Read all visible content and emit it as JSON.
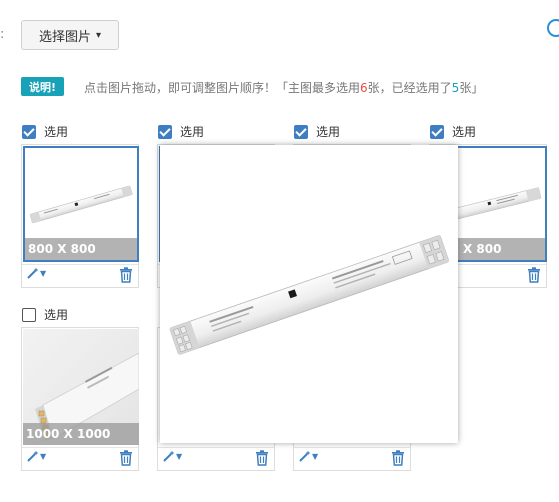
{
  "toolbar": {
    "colon": ":",
    "select_button_label": "选择图片",
    "chevron_icon": "chevron-down-icon"
  },
  "notice": {
    "badge": "说明!",
    "text_prefix": "点击图片拖动，即可调整图片顺序！「主图最多选用",
    "max_count": "6",
    "text_middle": "张，已经选用了",
    "selected_count": "5",
    "text_suffix": "张」"
  },
  "checkbox_label": "选用",
  "cards": [
    {
      "checked": true,
      "size_label": "800 X 800"
    },
    {
      "checked": true,
      "size_label": ""
    },
    {
      "checked": true,
      "size_label": ""
    },
    {
      "checked": true,
      "size_label": "X 800"
    },
    {
      "checked": false,
      "size_label": "1000 X 1000"
    }
  ],
  "icons": {
    "edit": "magic-wand-icon",
    "delete": "trash-icon",
    "caret": "caret-down-icon"
  },
  "colors": {
    "accent": "#3f7fc1",
    "badge": "#17a2b8",
    "max_count_color": "#e74c3c"
  }
}
